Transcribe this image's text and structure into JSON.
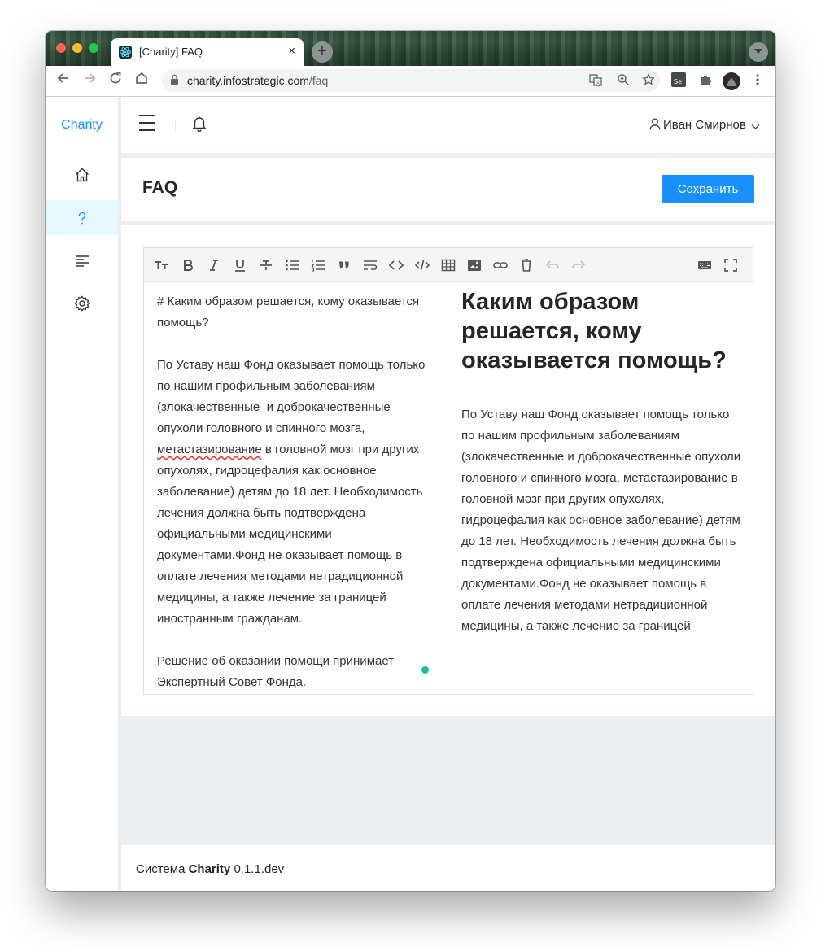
{
  "browser": {
    "tab_title": "[Charity] FAQ",
    "tab_close": "×",
    "new_tab": "+",
    "url_host": "charity.infostrategic.com",
    "url_path": "/faq"
  },
  "sidebar": {
    "brand": "Charity",
    "items": [
      {
        "icon": "home-icon"
      },
      {
        "icon": "question-icon",
        "label": "?",
        "active": true
      },
      {
        "icon": "align-left-icon"
      },
      {
        "icon": "settings-icon"
      }
    ]
  },
  "header": {
    "user_name": "Иван Смирнов"
  },
  "page": {
    "title": "FAQ",
    "save_label": "Сохранить"
  },
  "editor": {
    "toolbar": [
      "text-size-icon",
      "bold-icon",
      "italic-icon",
      "underline-icon",
      "strikethrough-icon",
      "bulleted-list-icon",
      "numbered-list-icon",
      "quote-icon",
      "wrap-icon",
      "code-icon",
      "code-block-icon",
      "table-icon",
      "image-icon",
      "link-icon",
      "trash-icon",
      "undo-icon",
      "redo-icon",
      "keyboard-icon",
      "fullscreen-icon"
    ],
    "source_heading": "# Каким образом решается, кому оказывается помощь?",
    "source_p1_a": "По Уставу наш Фонд оказывает помощь только по нашим профильным заболеваниям (злокачественные  и доброкачественные опухоли головного и спинного мозга, ",
    "source_p1_misspelled": "метастазирование",
    "source_p1_b": " в головной мозг при других опухолях, гидроцефалия как основное заболевание) детям до 18 лет. Необходимость лечения должна быть подтверждена официальными медицинскими документами.Фонд не оказывает помощь в оплате лечения методами нетрадиционной медицины, а также лечение за границей иностранным гражданам.",
    "source_p2": "Решение об оказании помощи принимает Экспертный Совет Фонда.",
    "preview_heading": "Каким образом решается, кому оказывается помощь?",
    "preview_p1": "По Уставу наш Фонд оказывает помощь только по нашим профильным заболеваниям (злокачественные и доброкачественные опухоли головного и спинного мозга, метастазирование в головной мозг при других опухолях, гидроцефалия как основное заболевание) детям до 18 лет. Необходимость лечения должна быть подтверждена официальными медицинскими документами.Фонд не оказывает помощь в оплате лечения методами нетрадиционной медицины, а также лечение за границей"
  },
  "footer": {
    "prefix": "Система",
    "brand": "Charity",
    "version": "0.1.1.dev"
  },
  "colors": {
    "primary": "#1890ff",
    "active_bg": "#e6f7ff",
    "status_dot": "#1abc9c"
  }
}
